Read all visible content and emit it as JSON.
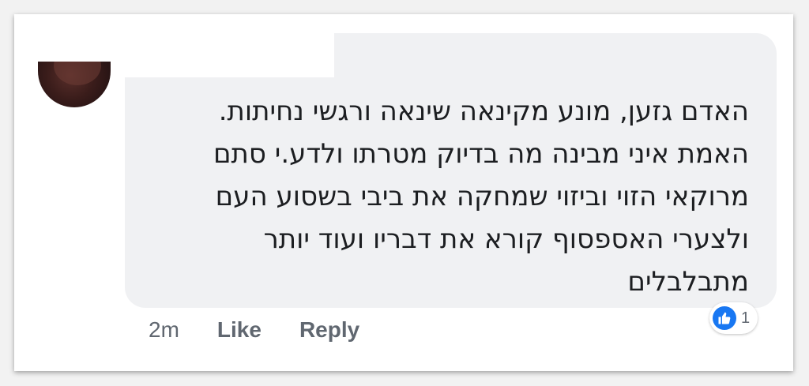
{
  "comment": {
    "lines": [
      "האדם גזען, מונע מקינאה שינאה ורגשי נחיתות.",
      "האמת איני מבינה מה בדיוק מטרתו ולדע.י סתם",
      "מרוקאי הזוי וביזוי שמחקה את ביבי בשסוע העם",
      "ולצערי האספסוף קורא את דבריו ועוד יותר",
      "מתבלבלים"
    ]
  },
  "actions": {
    "time": "2m",
    "like_label": "Like",
    "reply_label": "Reply"
  },
  "reactions": {
    "icon": "thumbs-up-icon",
    "count": "1"
  },
  "colors": {
    "bubble": "#f0f1f3",
    "accent": "#1877f2",
    "text": "#1c1e21",
    "muted": "#606770"
  }
}
